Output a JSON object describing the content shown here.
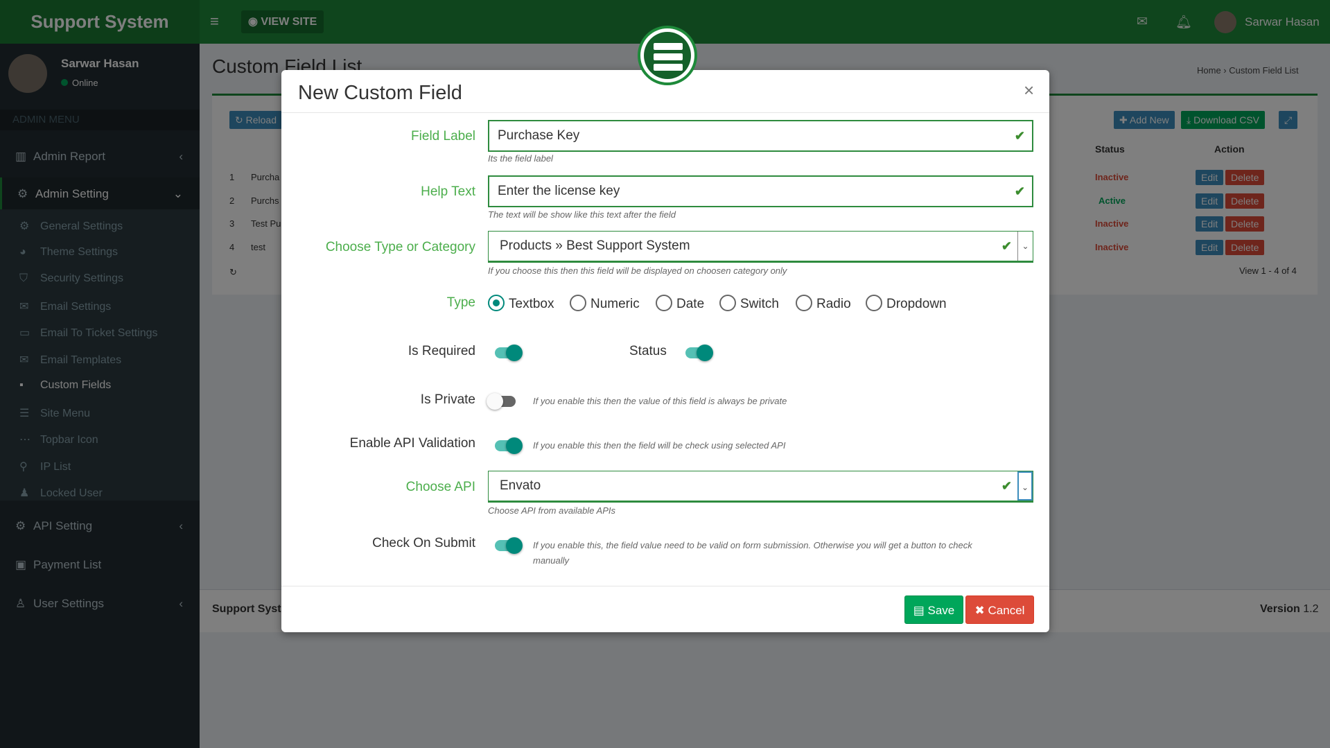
{
  "app": {
    "title": "Support System",
    "view_site": "VIEW SITE",
    "user_name": "Sarwar Hasan"
  },
  "sidebar": {
    "user_name": "Sarwar Hasan",
    "status": "Online",
    "menu_header": "ADMIN MENU",
    "items": [
      {
        "label": "Admin Report"
      },
      {
        "label": "Admin Setting"
      },
      {
        "label": "API Setting"
      },
      {
        "label": "Payment List"
      },
      {
        "label": "User Settings"
      }
    ],
    "sub_items": [
      {
        "label": "General Settings"
      },
      {
        "label": "Theme Settings"
      },
      {
        "label": "Security Settings"
      },
      {
        "label": "Email Settings"
      },
      {
        "label": "Email To Ticket Settings"
      },
      {
        "label": "Email Templates"
      },
      {
        "label": "Custom Fields"
      },
      {
        "label": "Site Menu"
      },
      {
        "label": "Topbar Icon"
      },
      {
        "label": "IP List"
      },
      {
        "label": "Locked User"
      }
    ]
  },
  "content": {
    "title": "Custom Field List",
    "breadcrumb": {
      "home": "Home",
      "current": "Custom Field List"
    },
    "reload": "Reload",
    "add_new": "Add New",
    "download_csv": "Download CSV",
    "columns": {
      "status": "Status",
      "action": "Action"
    },
    "rows": [
      {
        "n": "1",
        "name": "Purcha",
        "status": "Inactive"
      },
      {
        "n": "2",
        "name": "Purchs",
        "status": "Active"
      },
      {
        "n": "3",
        "name": "Test Pu",
        "status": "Inactive"
      },
      {
        "n": "4",
        "name": "test",
        "status": "Inactive"
      }
    ],
    "edit": "Edit",
    "delete": "Delete",
    "pager": "View 1 - 4 of 4"
  },
  "footer": {
    "left": "Support Syst",
    "version_label": "Version",
    "version": "1.2"
  },
  "modal": {
    "title": "New Custom Field",
    "field_label": {
      "label": "Field Label",
      "value": "Purchase Key",
      "help": "Its the field label"
    },
    "help_text": {
      "label": "Help Text",
      "value": "Enter the license key",
      "help": "The text will be show like this text after the field"
    },
    "category": {
      "label": "Choose Type or Category",
      "value": "Products » Best Support System",
      "help": "If you choose this then this field will be displayed on choosen category only"
    },
    "type": {
      "label": "Type",
      "options": [
        "Textbox",
        "Numeric",
        "Date",
        "Switch",
        "Radio",
        "Dropdown"
      ],
      "selected": "Textbox"
    },
    "is_required": {
      "label": "Is Required",
      "on": true
    },
    "status": {
      "label": "Status",
      "on": true
    },
    "is_private": {
      "label": "Is Private",
      "on": false,
      "note": "If you enable this then the value of this field is always be private"
    },
    "api_validation": {
      "label": "Enable API Validation",
      "on": true,
      "note": "If you enable this then the field will be check using selected API"
    },
    "choose_api": {
      "label": "Choose API",
      "value": "Envato",
      "help": "Choose API from available APIs"
    },
    "check_on_submit": {
      "label": "Check On Submit",
      "on": true,
      "note_line1": "If you enable this, the field value need to be valid on form submission. Otherwise you will get a button to check",
      "note_line2": "manually"
    },
    "save": "Save",
    "cancel": "Cancel"
  },
  "colors": {
    "brand": "#1e8a3a",
    "label_green": "#4cae4c",
    "toggle_on": "#00897b",
    "save": "#00a65a",
    "cancel": "#dd4b39"
  }
}
